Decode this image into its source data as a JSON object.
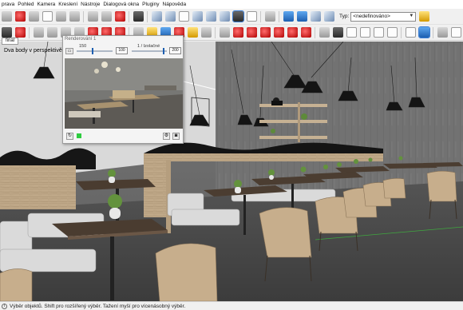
{
  "menu": {
    "items": [
      "prava",
      "Pohled",
      "Kamera",
      "Kreslení",
      "Nástroje",
      "Dialogová okna",
      "Pluginy",
      "Nápověda"
    ]
  },
  "toolbar1": {
    "tools": [
      {
        "icon": "select-arrow-icon",
        "color": "grey"
      },
      {
        "icon": "eraser-icon",
        "color": "red"
      },
      {
        "icon": "cut-icon",
        "color": "grey"
      },
      {
        "icon": "copy-icon",
        "color": "white"
      },
      {
        "icon": "paste-icon",
        "color": "grey"
      },
      {
        "icon": "delete-icon",
        "color": "grey"
      },
      {
        "icon": "undo-icon",
        "color": "grey"
      },
      {
        "icon": "redo-icon",
        "color": "grey"
      },
      {
        "icon": "model-info-icon",
        "color": "red"
      },
      {
        "icon": "components-icon",
        "color": "dark"
      },
      {
        "icon": "iso-view-icon",
        "color": "cube"
      },
      {
        "icon": "top-view-icon",
        "color": "cube"
      },
      {
        "icon": "front-view-icon",
        "color": "white"
      },
      {
        "icon": "right-view-icon",
        "color": "cube"
      },
      {
        "icon": "xray-icon",
        "color": "cube"
      },
      {
        "icon": "wireframe-icon",
        "color": "cube"
      },
      {
        "icon": "shaded-textures-icon",
        "color": "dark"
      },
      {
        "icon": "monochrome-icon",
        "color": "white"
      },
      {
        "icon": "axes-icon",
        "color": "grey"
      },
      {
        "icon": "cube-select-icon",
        "color": "blue"
      },
      {
        "icon": "cube-blue-icon",
        "color": "blue"
      },
      {
        "icon": "cube-front-icon",
        "color": "cube"
      },
      {
        "icon": "cube-side-icon",
        "color": "cube"
      }
    ],
    "tag_label": "Typ:",
    "tag_value": "<nedefinováno>",
    "tag_icon": "tag-manager-icon"
  },
  "toolbar2": {
    "tools": [
      {
        "icon": "line-tool-icon",
        "color": "dark"
      },
      {
        "icon": "freehand-tool-icon",
        "color": "red"
      },
      {
        "icon": "rectangle-tool-icon",
        "color": "grey"
      },
      {
        "icon": "circle-tool-icon",
        "color": "grey"
      },
      {
        "icon": "polygon-tool-icon",
        "color": "grey"
      },
      {
        "icon": "push-pull-icon",
        "color": "grey"
      },
      {
        "icon": "move-tool-icon",
        "color": "red"
      },
      {
        "icon": "rotate-tool-icon",
        "color": "red"
      },
      {
        "icon": "offset-tool-icon",
        "color": "red"
      },
      {
        "icon": "tape-measure-icon",
        "color": "grey"
      },
      {
        "icon": "protractor-icon",
        "color": "yellow"
      },
      {
        "icon": "paint-bucket-icon",
        "color": "blue"
      },
      {
        "icon": "orbit-tool-icon",
        "color": "red"
      },
      {
        "icon": "pan-tool-icon",
        "color": "yellow"
      },
      {
        "icon": "zoom-tool-icon",
        "color": "grey"
      },
      {
        "icon": "zoom-extents-icon",
        "color": "grey"
      },
      {
        "icon": "previous-view-icon",
        "color": "red"
      },
      {
        "icon": "render-plugin-icon",
        "color": "red"
      },
      {
        "icon": "render-settings-icon",
        "color": "red"
      },
      {
        "icon": "render-material-icon",
        "color": "red"
      },
      {
        "icon": "render-light-icon",
        "color": "red"
      },
      {
        "icon": "render-camera-icon",
        "color": "red"
      },
      {
        "icon": "sandbox-icon",
        "color": "grey"
      },
      {
        "icon": "warehouse-icon",
        "color": "dark"
      },
      {
        "icon": "house-icon",
        "color": "white"
      },
      {
        "icon": "house-side-icon",
        "color": "white"
      },
      {
        "icon": "house-roof-icon",
        "color": "white"
      },
      {
        "icon": "house-back-icon",
        "color": "white"
      },
      {
        "icon": "section-plane-icon",
        "color": "white"
      },
      {
        "icon": "display-section-icon",
        "color": "blue"
      },
      {
        "icon": "section-cut-icon",
        "color": "grey"
      },
      {
        "icon": "shadows-icon",
        "color": "white"
      },
      {
        "icon": "fog-icon",
        "color": "white"
      },
      {
        "icon": "camera-position-icon",
        "color": "white"
      },
      {
        "icon": "look-around-icon",
        "color": "white"
      },
      {
        "icon": "walk-tool-icon",
        "color": "white"
      },
      {
        "icon": "extension-icon",
        "color": "blue"
      }
    ]
  },
  "viewport": {
    "scene_tab": "final",
    "scene_label": "Dva body v perspektivě"
  },
  "render_window": {
    "title": "Renderování 1",
    "quality_label": "150",
    "samples_label": "1 / Izolačné",
    "quality_value": "100",
    "samples_value": "200",
    "quality_fraction": 0.45,
    "samples_fraction": 0.92,
    "status_color": "#2ecc40",
    "refresh_icon": "refresh-icon",
    "settings_icon": "gear-icon",
    "camera_icon": "camera-icon"
  },
  "statusbar": {
    "text": "Výběr objektů. Shift pro rozšířený výběr. Tažení myší pro vícenásobný výběr.",
    "icon": "info-icon"
  }
}
